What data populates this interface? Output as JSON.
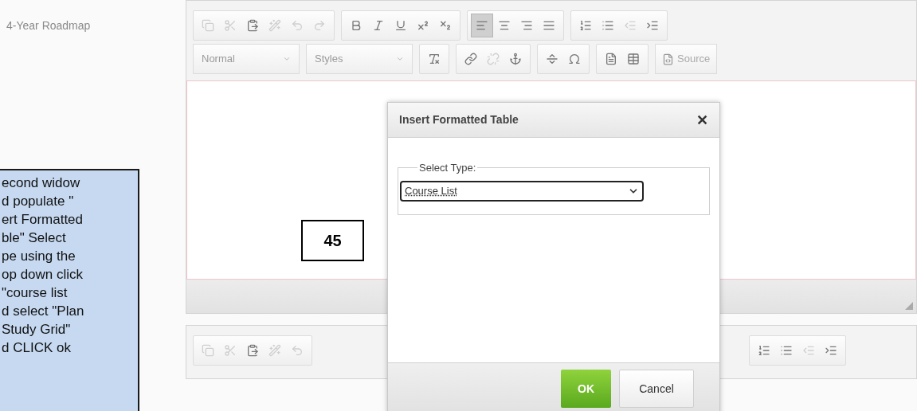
{
  "field_label": "4-Year Roadmap",
  "editor": {
    "toolbar_row1": [
      [
        {
          "kind": "copy",
          "disabled": true
        },
        {
          "kind": "cut",
          "disabled": true
        },
        {
          "kind": "paste",
          "disabled": false
        },
        {
          "kind": "wand",
          "disabled": true
        },
        {
          "kind": "undo",
          "disabled": true
        },
        {
          "kind": "redo",
          "disabled": true
        }
      ],
      [
        {
          "kind": "bold",
          "disabled": false
        },
        {
          "kind": "italic",
          "disabled": false
        },
        {
          "kind": "underline",
          "disabled": false
        },
        {
          "kind": "superscript",
          "disabled": false
        },
        {
          "kind": "subscript",
          "disabled": false
        }
      ],
      [
        {
          "kind": "align-left",
          "disabled": false,
          "active": true
        },
        {
          "kind": "align-center",
          "disabled": false,
          "active": false
        },
        {
          "kind": "align-right",
          "disabled": false,
          "active": false
        },
        {
          "kind": "align-justify",
          "disabled": false,
          "active": false
        }
      ],
      [
        {
          "kind": "numbered-list",
          "disabled": false
        },
        {
          "kind": "bulleted-list",
          "disabled": false
        },
        {
          "kind": "outdent",
          "disabled": true
        },
        {
          "kind": "indent",
          "disabled": false
        }
      ]
    ],
    "dropdowns": [
      "Normal",
      "Styles"
    ],
    "toolbar_row2": [
      [
        {
          "kind": "clear-format",
          "disabled": false
        }
      ],
      [
        {
          "kind": "link",
          "disabled": false
        },
        {
          "kind": "unlink",
          "disabled": true
        },
        {
          "kind": "anchor",
          "disabled": false
        }
      ],
      [
        {
          "kind": "rule",
          "disabled": false
        },
        {
          "kind": "omega",
          "disabled": false
        }
      ],
      [
        {
          "kind": "template",
          "disabled": false
        },
        {
          "kind": "table",
          "disabled": false
        }
      ]
    ],
    "source_button": "Source"
  },
  "lower_editor": {
    "left_group": [
      {
        "kind": "copy",
        "disabled": true
      },
      {
        "kind": "cut",
        "disabled": true
      },
      {
        "kind": "paste",
        "disabled": false
      },
      {
        "kind": "wand",
        "disabled": true
      },
      {
        "kind": "undo",
        "disabled": true
      }
    ],
    "right_group": [
      {
        "kind": "numbered-list",
        "disabled": false
      },
      {
        "kind": "bulleted-list",
        "disabled": false
      },
      {
        "kind": "outdent",
        "disabled": true
      },
      {
        "kind": "indent",
        "disabled": false
      }
    ]
  },
  "step_number": "45",
  "annotation_lines": [
    "econd widow",
    "d populate \"",
    "ert Formatted",
    "ble\"  Select",
    "pe using the",
    "op down click",
    "\"course list",
    "d select \"Plan",
    "Study Grid\"",
    "d CLICK ok"
  ],
  "dialog": {
    "title": "Insert Formatted Table",
    "close": "✕",
    "fieldset_legend": "Select Type:",
    "select_value": "Course List",
    "buttons": {
      "ok": "OK",
      "cancel": "Cancel"
    }
  }
}
